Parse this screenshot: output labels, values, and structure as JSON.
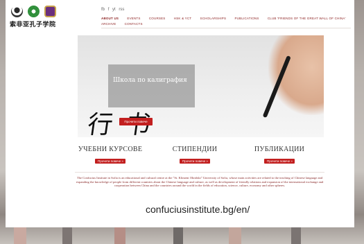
{
  "header": {
    "logo_text": "索非亚孔子学院",
    "social": [
      "fb",
      "f",
      "yt",
      "rss"
    ],
    "nav_row1": [
      "About us",
      "Events",
      "Courses",
      "Hsk & Yct",
      "Scholarships",
      "Publications",
      "Club 'Friends of the Great Wall of China'"
    ],
    "nav_row2": [
      "Archive",
      "Contacts"
    ]
  },
  "hero": {
    "box_title": "Школа по калиграфия",
    "box_button": "Прочети повече",
    "calligraphy": "行书"
  },
  "columns": [
    {
      "title": "УЧЕБНИ КУРСОВЕ",
      "button": "Прочети повече »"
    },
    {
      "title": "СТИПЕНДИИ",
      "button": "Прочети повече »"
    },
    {
      "title": "ПУБЛИКАЦИИ",
      "button": "Прочети повече »"
    }
  ],
  "body": {
    "paragraph": "The Confucius Institute in Sofia is an educational and cultural centre at the \"St. Kliment Ohridski\" University of Sofia, whose main activities are related to the teaching of Chinese language and expanding the knowledge of people from different countries about the Chinese language and culture, as well as development of friendly relations and expansion of the international exchange and cooperation between China and the countries around the world in the fields of education, science, culture, economy and other spheres."
  },
  "caption": {
    "url": "confuciusinstitute.bg/en/"
  }
}
